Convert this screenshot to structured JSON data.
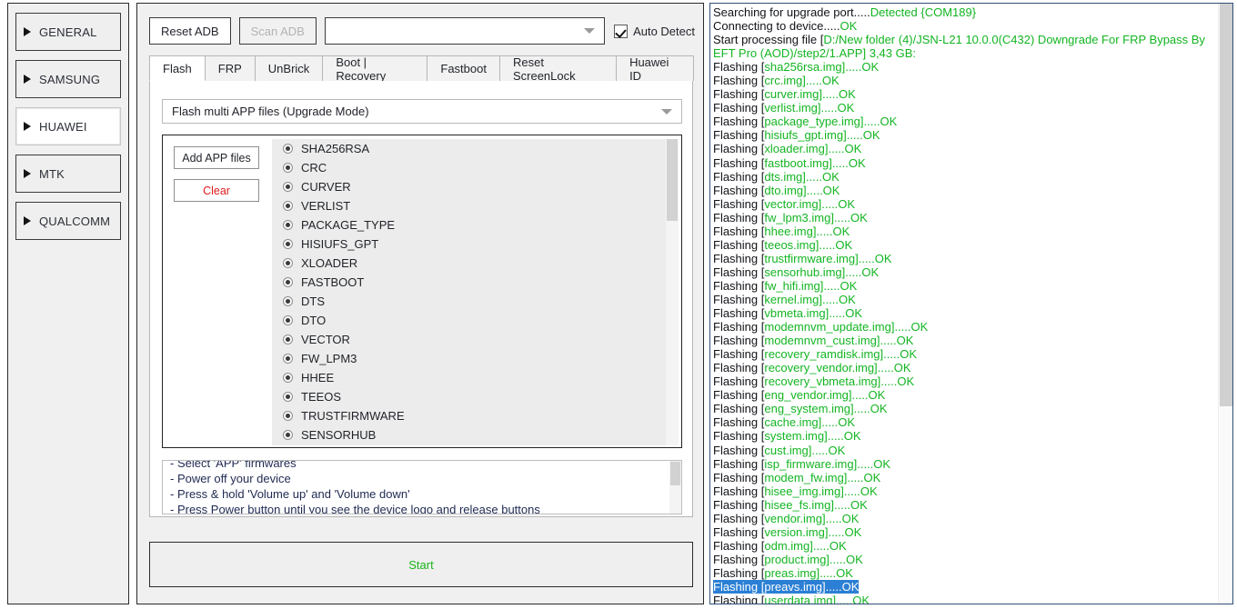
{
  "sidebar": {
    "items": [
      {
        "label": "GENERAL",
        "selected": false
      },
      {
        "label": "SAMSUNG",
        "selected": false
      },
      {
        "label": "HUAWEI",
        "selected": true
      },
      {
        "label": "MTK",
        "selected": false
      },
      {
        "label": "QUALCOMM",
        "selected": false
      }
    ]
  },
  "toolbar": {
    "reset_adb_label": "Reset ADB",
    "scan_adb_label": "Scan ADB",
    "port_combo_value": "",
    "auto_detect_label": "Auto Detect",
    "auto_detect_checked": true
  },
  "tabs": [
    {
      "label": "Flash",
      "active": true
    },
    {
      "label": "FRP",
      "active": false
    },
    {
      "label": "UnBrick",
      "active": false
    },
    {
      "label": "Boot | Recovery",
      "active": false
    },
    {
      "label": "Fastboot",
      "active": false
    },
    {
      "label": "Reset ScreenLock",
      "active": false
    },
    {
      "label": "Huawei ID",
      "active": false
    }
  ],
  "flash_tab": {
    "mode_combo_value": "Flash multi APP files (Upgrade Mode)",
    "add_files_label": "Add APP files",
    "clear_label": "Clear",
    "partitions": [
      "SHA256RSA",
      "CRC",
      "CURVER",
      "VERLIST",
      "PACKAGE_TYPE",
      "HISIUFS_GPT",
      "XLOADER",
      "FASTBOOT",
      "DTS",
      "DTO",
      "VECTOR",
      "FW_LPM3",
      "HHEE",
      "TEEOS",
      "TRUSTFIRMWARE",
      "SENSORHUB"
    ],
    "instructions": [
      "- Select 'APP' firmwares",
      "- Power off your device",
      "- Press & hold 'Volume up' and 'Volume down'",
      "- Press Power button until you see the device logo and release buttons"
    ],
    "start_label": "Start"
  },
  "log": {
    "lines": [
      {
        "prefix": "Searching for upgrade port.....",
        "green": "Detected {COM189}",
        "suffix": "",
        "selected": false
      },
      {
        "prefix": "Connecting to device.....",
        "green": "OK",
        "suffix": "",
        "selected": false
      },
      {
        "prefix": "Start processing file [",
        "green": "D:/New folder (4)/JSN-L21 10.0.0(C432) Downgrade For FRP Bypass By EFT Pro (AOD)/step2/1.APP",
        "suffix": "] 3,43 GB:",
        "selected": false
      },
      {
        "prefix": "Flashing [",
        "green": "sha256rsa.img",
        "suffix": "].....OK",
        "selected": false
      },
      {
        "prefix": "Flashing [",
        "green": "crc.img",
        "suffix": "].....OK",
        "selected": false
      },
      {
        "prefix": "Flashing [",
        "green": "curver.img",
        "suffix": "].....OK",
        "selected": false
      },
      {
        "prefix": "Flashing [",
        "green": "verlist.img",
        "suffix": "].....OK",
        "selected": false
      },
      {
        "prefix": "Flashing [",
        "green": "package_type.img",
        "suffix": "].....OK",
        "selected": false
      },
      {
        "prefix": "Flashing [",
        "green": "hisiufs_gpt.img",
        "suffix": "].....OK",
        "selected": false
      },
      {
        "prefix": "Flashing [",
        "green": "xloader.img",
        "suffix": "].....OK",
        "selected": false
      },
      {
        "prefix": "Flashing [",
        "green": "fastboot.img",
        "suffix": "].....OK",
        "selected": false
      },
      {
        "prefix": "Flashing [",
        "green": "dts.img",
        "suffix": "].....OK",
        "selected": false
      },
      {
        "prefix": "Flashing [",
        "green": "dto.img",
        "suffix": "].....OK",
        "selected": false
      },
      {
        "prefix": "Flashing [",
        "green": "vector.img",
        "suffix": "].....OK",
        "selected": false
      },
      {
        "prefix": "Flashing [",
        "green": "fw_lpm3.img",
        "suffix": "].....OK",
        "selected": false
      },
      {
        "prefix": "Flashing [",
        "green": "hhee.img",
        "suffix": "].....OK",
        "selected": false
      },
      {
        "prefix": "Flashing [",
        "green": "teeos.img",
        "suffix": "].....OK",
        "selected": false
      },
      {
        "prefix": "Flashing [",
        "green": "trustfirmware.img",
        "suffix": "].....OK",
        "selected": false
      },
      {
        "prefix": "Flashing [",
        "green": "sensorhub.img",
        "suffix": "].....OK",
        "selected": false
      },
      {
        "prefix": "Flashing [",
        "green": "fw_hifi.img",
        "suffix": "].....OK",
        "selected": false
      },
      {
        "prefix": "Flashing [",
        "green": "kernel.img",
        "suffix": "].....OK",
        "selected": false
      },
      {
        "prefix": "Flashing [",
        "green": "vbmeta.img",
        "suffix": "].....OK",
        "selected": false
      },
      {
        "prefix": "Flashing [",
        "green": "modemnvm_update.img",
        "suffix": "].....OK",
        "selected": false
      },
      {
        "prefix": "Flashing [",
        "green": "modemnvm_cust.img",
        "suffix": "].....OK",
        "selected": false
      },
      {
        "prefix": "Flashing [",
        "green": "recovery_ramdisk.img",
        "suffix": "].....OK",
        "selected": false
      },
      {
        "prefix": "Flashing [",
        "green": "recovery_vendor.img",
        "suffix": "].....OK",
        "selected": false
      },
      {
        "prefix": "Flashing [",
        "green": "recovery_vbmeta.img",
        "suffix": "].....OK",
        "selected": false
      },
      {
        "prefix": "Flashing [",
        "green": "eng_vendor.img",
        "suffix": "].....OK",
        "selected": false
      },
      {
        "prefix": "Flashing [",
        "green": "eng_system.img",
        "suffix": "].....OK",
        "selected": false
      },
      {
        "prefix": "Flashing [",
        "green": "cache.img",
        "suffix": "].....OK",
        "selected": false
      },
      {
        "prefix": "Flashing [",
        "green": "system.img",
        "suffix": "].....OK",
        "selected": false
      },
      {
        "prefix": "Flashing [",
        "green": "cust.img",
        "suffix": "].....OK",
        "selected": false
      },
      {
        "prefix": "Flashing [",
        "green": "isp_firmware.img",
        "suffix": "].....OK",
        "selected": false
      },
      {
        "prefix": "Flashing [",
        "green": "modem_fw.img",
        "suffix": "].....OK",
        "selected": false
      },
      {
        "prefix": "Flashing [",
        "green": "hisee_img.img",
        "suffix": "].....OK",
        "selected": false
      },
      {
        "prefix": "Flashing [",
        "green": "hisee_fs.img",
        "suffix": "].....OK",
        "selected": false
      },
      {
        "prefix": "Flashing [",
        "green": "vendor.img",
        "suffix": "].....OK",
        "selected": false
      },
      {
        "prefix": "Flashing [",
        "green": "version.img",
        "suffix": "].....OK",
        "selected": false
      },
      {
        "prefix": "Flashing [",
        "green": "odm.img",
        "suffix": "].....OK",
        "selected": false
      },
      {
        "prefix": "Flashing [",
        "green": "product.img",
        "suffix": "].....OK",
        "selected": false
      },
      {
        "prefix": "Flashing [",
        "green": "preas.img",
        "suffix": "].....OK",
        "selected": false
      },
      {
        "prefix": "Flashing [",
        "green": "preavs.img",
        "suffix": "].....OK",
        "selected": true
      },
      {
        "prefix": "Flashing [",
        "green": "userdata.img",
        "suffix": "].....OK",
        "selected": false
      }
    ]
  },
  "colors": {
    "log_green": "#13b522",
    "selection_blue": "#2b7fd4",
    "start_green": "#19b519",
    "clear_red": "#e01b1b"
  }
}
